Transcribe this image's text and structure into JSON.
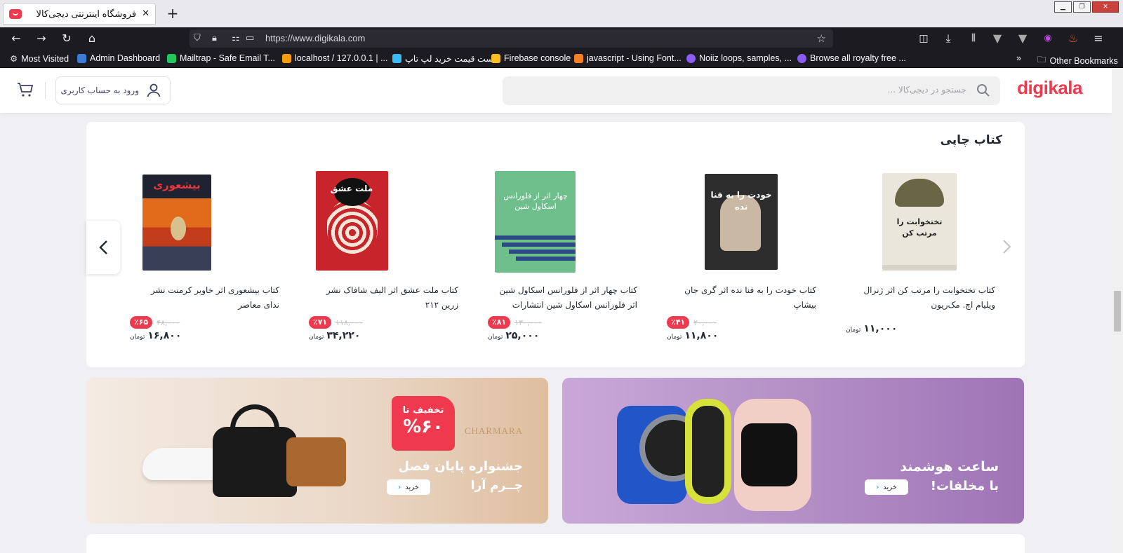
{
  "browser": {
    "tab_title": "فروشگاه اینترنتی دیجی‌کالا",
    "tab_close": "✕",
    "new_tab": "+",
    "url": "https://www.digikala.com",
    "bookmarks": [
      {
        "label": "Most Visited",
        "color": "#9aa0a6"
      },
      {
        "label": "Admin Dashboard",
        "color": "#3b7cd6"
      },
      {
        "label": "Mailtrap - Safe Email T...",
        "color": "#22c55e"
      },
      {
        "label": "localhost / 127.0.0.1 | ...",
        "color": "#f59e0b"
      },
      {
        "label": "لیست قیمت خرید لپ تاپ",
        "color": "#38bdf8"
      },
      {
        "label": "Firebase console",
        "color": "#fbbf24"
      },
      {
        "label": "javascript - Using Font...",
        "color": "#f48024"
      },
      {
        "label": "Noiiz loops, samples, ...",
        "color": "#8b5cf6"
      },
      {
        "label": "Browse all royalty free ...",
        "color": "#8b5cf6"
      }
    ],
    "other_bookmarks": "Other Bookmarks"
  },
  "header": {
    "logo": "digikala",
    "search_placeholder": "جستجو در دیجی‌کالا ...",
    "login_label": "ورود به حساب کاربری"
  },
  "books_section": {
    "title": "کتاب چاپی",
    "items": [
      {
        "name_line1": "کتاب تختخوابت را مرتب کن اثر ژنرال",
        "name_line2": "ویلیام اچ. مک‌ریون",
        "discount": "",
        "old_price": "",
        "price": "۱۱,۰۰۰",
        "currency": "تومان",
        "cover_color": "#e6e1d6"
      },
      {
        "name_line1": "کتاب خودت را به فنا نده اثر گری جان",
        "name_line2": "بیشاپ",
        "discount": "٪۴۱",
        "old_price": "۲۰,۰۰۰",
        "price": "۱۱,۸۰۰",
        "currency": "تومان",
        "cover_color": "#2d2d2d"
      },
      {
        "name_line1": "کتاب چهار اثر از فلورانس اسکاول شین",
        "name_line2": "اثر فلورانس اسکاول شین انتشارات",
        "discount": "٪۸۱",
        "old_price": "۱۳۰,۰۰۰",
        "price": "۲۵,۰۰۰",
        "currency": "تومان",
        "cover_color": "#6fbf8c"
      },
      {
        "name_line1": "کتاب ملت عشق اثر الیف شافاک نشر",
        "name_line2": "زرین ۲۱۲",
        "discount": "٪۷۱",
        "old_price": "۱۱۸,۰۰۰",
        "price": "۳۴,۲۲۰",
        "currency": "تومان",
        "cover_color": "#c8242c"
      },
      {
        "name_line1": "کتاب بیشعوری اثر خاویر کرمنت نشر",
        "name_line2": "ندای معاصر",
        "discount": "٪۶۵",
        "old_price": "۴۸,۰۰۰",
        "price": "۱۶,۸۰۰",
        "currency": "تومان",
        "cover_color": "#3a2a20"
      }
    ],
    "cover_titles": [
      "تختخوابت را مرتب کن",
      "خودت را به فنا نده",
      "چهار اثر از فلورانس اسکاول شین",
      "ملت عشق",
      "بیشعوری"
    ]
  },
  "banners": {
    "left": {
      "title1": "جشنواره پایان فصل",
      "title2": "چــرم آرا",
      "badge_title": "تخفیف تا",
      "badge_value": "%۶۰",
      "brand": "CHARMARA",
      "button": "خرید"
    },
    "right": {
      "title1": "ساعت هوشمند",
      "title2": "با مخلفات!",
      "button": "خرید"
    }
  }
}
